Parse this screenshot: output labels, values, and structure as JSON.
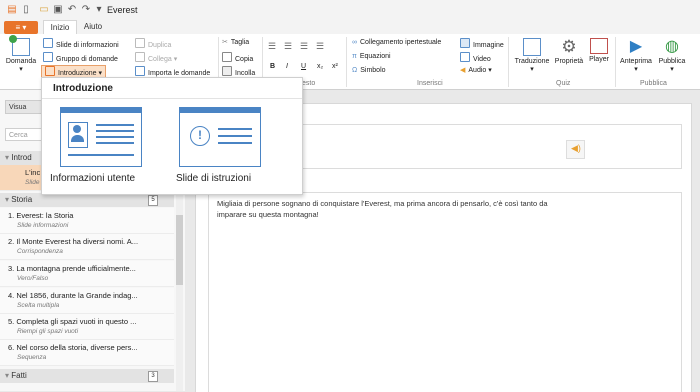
{
  "app": {
    "title": "Everest"
  },
  "tabs": {
    "file": "≡",
    "inizio": "Inizio",
    "aiuto": "Aiuto"
  },
  "ribbon": {
    "domanda": "Domanda",
    "slide_info": "Slide di informazioni",
    "gruppo": "Gruppo di domande",
    "introduzione": "Introduzione",
    "duplica": "Duplica",
    "collega": "Collega",
    "importa": "Importa le domande",
    "taglia": "Taglia",
    "copia": "Copia",
    "incolla": "Incolla",
    "bold": "B",
    "italic": "I",
    "underline": "U",
    "subscript": "x₂",
    "superscript": "x²",
    "collegamento": "Collegamento ipertestuale",
    "equazioni": "Equazioni",
    "simbolo": "Simbolo",
    "immagine": "Immagine",
    "video": "Video",
    "audio": "Audio",
    "traduzione": "Traduzione",
    "proprieta": "Proprietà",
    "player": "Player",
    "anteprima": "Anteprima",
    "pubblica": "Pubblica",
    "group_testo": "esto",
    "group_inserisci": "Inserisci",
    "group_quiz": "Quiz",
    "group_pubblica": "Pubblica"
  },
  "dropdown": {
    "title": "Introduzione",
    "option1": "Informazioni utente",
    "option2": "Slide di istruzioni"
  },
  "left": {
    "visualizza": "Visua",
    "search_placeholder": "Cerca",
    "intro_section": "Introd",
    "intro_item_title": "L'inc",
    "intro_item_sub": "Slide",
    "storia_section": "Storia",
    "storia_count": "5",
    "fatti_section": "Fatti",
    "fatti_count": "3",
    "items": [
      {
        "title": "1. Everest: la Storia",
        "sub": "Slide informazioni"
      },
      {
        "title": "2. Il Monte Everest ha diversi nomi. A...",
        "sub": "Corrispondenza"
      },
      {
        "title": "3. La montagna prende ufficialmente...",
        "sub": "Vero/Falso"
      },
      {
        "title": "4. Nel 1856, durante la Grande indag...",
        "sub": "Scelta multipla"
      },
      {
        "title": "5. Completa gli spazi vuoti in questo ...",
        "sub": "Riempi gli spazi vuoti"
      },
      {
        "title": "6. Nel corso della storia, diverse pers...",
        "sub": "Sequenza"
      }
    ]
  },
  "main": {
    "content": "Migliaia di persone sognano di conquistare l'Everest, ma prima ancora di pensarlo, c'è così tanto da imparare su questa montagna!"
  },
  "colors": {
    "accent_orange": "#e8742a",
    "accent_blue": "#4a84c4"
  }
}
